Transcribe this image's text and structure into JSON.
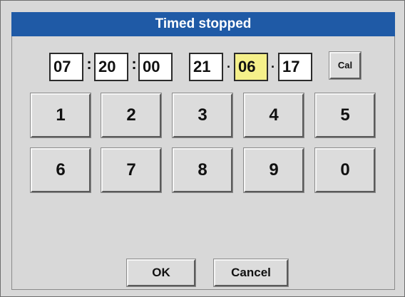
{
  "dialog": {
    "title": "Timed stopped"
  },
  "datetime": {
    "hour": "07",
    "minute": "20",
    "second": "00",
    "field4": "21",
    "field5": "06",
    "field6": "17",
    "time_separator": ":",
    "date_separator": "·",
    "active_field": "field5"
  },
  "calendar_button": {
    "label": "Cal"
  },
  "keypad": {
    "keys": [
      "1",
      "2",
      "3",
      "4",
      "5",
      "6",
      "7",
      "8",
      "9",
      "0"
    ]
  },
  "actions": {
    "ok_label": "OK",
    "cancel_label": "Cancel"
  },
  "colors": {
    "title_bar": "#1f5aa6",
    "background": "#d8d8d8",
    "active_field": "#f5f08a"
  }
}
